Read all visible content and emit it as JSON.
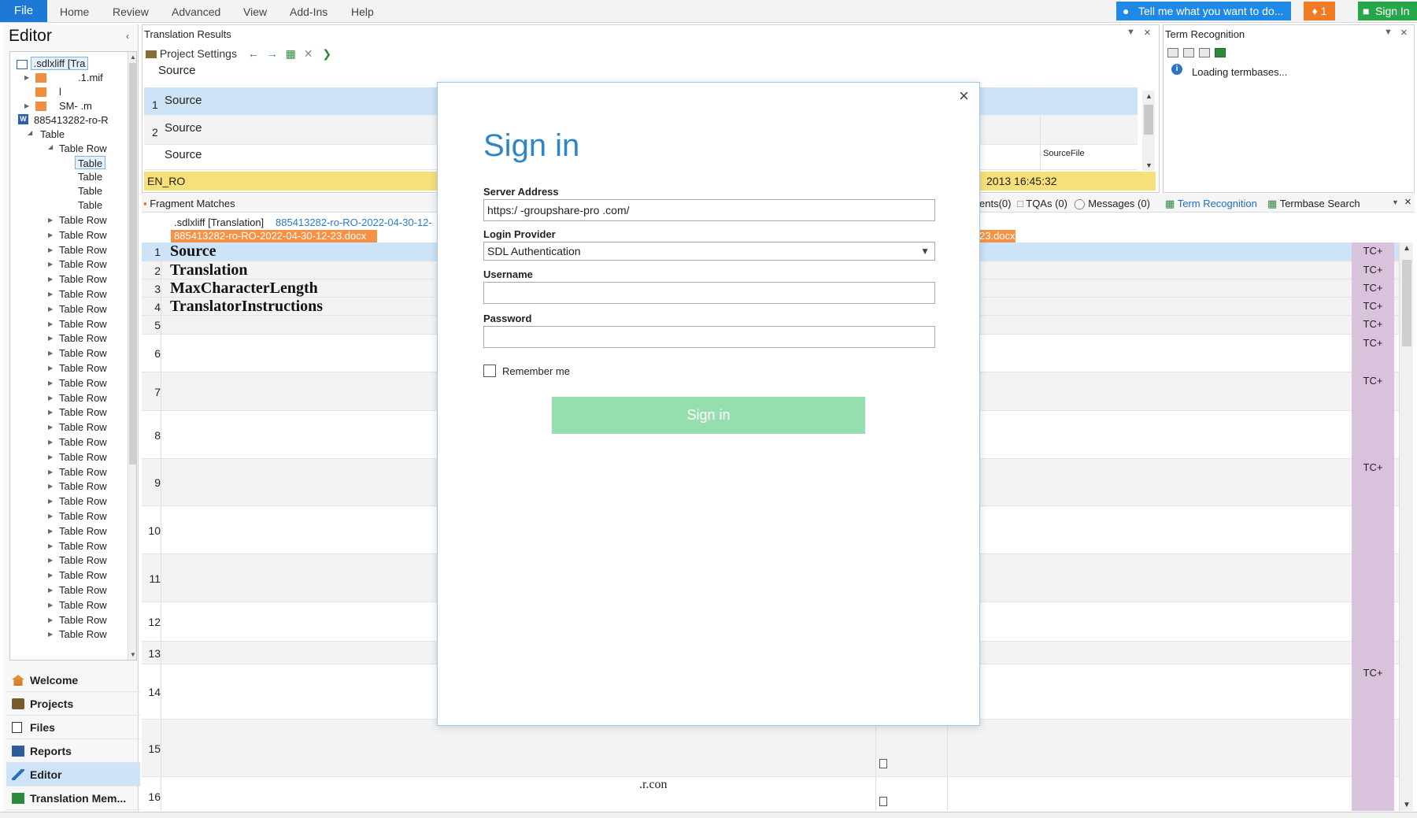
{
  "ribbon": {
    "file": "File",
    "tabs": [
      "Home",
      "Review",
      "Advanced",
      "View",
      "Add-Ins",
      "Help"
    ],
    "tell_me": "Tell me what you want to do...",
    "notifications": "1",
    "sign_in": "Sign In"
  },
  "left_panel": {
    "title": "Editor",
    "tree": {
      "root": ".sdlxliff [Tra",
      "files": [
        ".1.mif",
        "l",
        "SM-       .m"
      ],
      "doc": "885413282-ro-R",
      "table": "Table",
      "table_row": "Table Row",
      "child_tables": [
        "Table",
        "Table",
        "Table",
        "Table"
      ]
    },
    "nav": [
      {
        "label": "Welcome",
        "icon": "home-icon"
      },
      {
        "label": "Projects",
        "icon": "projects-icon"
      },
      {
        "label": "Files",
        "icon": "files-icon"
      },
      {
        "label": "Reports",
        "icon": "reports-icon"
      },
      {
        "label": "Editor",
        "icon": "editor-icon"
      },
      {
        "label": "Translation Mem...",
        "icon": "translation-memory-icon"
      }
    ]
  },
  "translation_results": {
    "title": "Translation Results",
    "project_settings": "Project Settings",
    "source_header": "Source",
    "rows": [
      {
        "num": "1",
        "source": "Source"
      },
      {
        "num": "2",
        "source": "Source"
      },
      {
        "num": "",
        "source": "Source"
      }
    ],
    "source_file": "SourceFile",
    "lang": "EN_RO",
    "date": "2013 16:45:32"
  },
  "term_recognition": {
    "title": "Term Recognition",
    "loading": "Loading termbases..."
  },
  "bottom_tabs": {
    "fragment_matches": "Fragment Matches",
    "comments": "ents(0)",
    "tqas": "TQAs (0)",
    "messages": "Messages (0)",
    "term_recognition": "Term Recognition",
    "termbase_search": "Termbase Search"
  },
  "editor": {
    "doc_tab_1": ".sdlxliff [Translation]",
    "doc_tab_2": "885413282-ro-RO-2022-04-30-12-",
    "doc_bar_left": "885413282-ro-RO-2022-04-30-12-23.docx",
    "doc_bar_right": "23.docx",
    "rows": [
      {
        "n": "1",
        "text": "Source",
        "tc": "TC+"
      },
      {
        "n": "2",
        "text": "Translation",
        "tc": "TC+"
      },
      {
        "n": "3",
        "text": "MaxCharacterLength",
        "tc": "TC+"
      },
      {
        "n": "4",
        "text": "TranslatorInstructions",
        "tc": "TC+"
      },
      {
        "n": "5",
        "text": "",
        "tc": "TC+"
      },
      {
        "n": "6",
        "text": "",
        "tc": "TC+"
      },
      {
        "n": "7",
        "text": "",
        "tc": "TC+"
      },
      {
        "n": "8",
        "text": "",
        "tc": ""
      },
      {
        "n": "9",
        "text": "",
        "tc": "TC+"
      },
      {
        "n": "10",
        "text": "",
        "tc": ""
      },
      {
        "n": "11",
        "text": "",
        "tc": ""
      },
      {
        "n": "12",
        "text": "",
        "tc": ""
      },
      {
        "n": "13",
        "text": "",
        "tc": ""
      },
      {
        "n": "14",
        "text": "",
        "tc": "TC+"
      },
      {
        "n": "15",
        "text": "",
        "tc": ""
      },
      {
        "n": "16",
        "text": "",
        "tc": ""
      }
    ],
    "fragment_text": ".r.con"
  },
  "dialog": {
    "title": "Sign in",
    "server_label": "Server Address",
    "server_value": "https:/      -groupshare-pro            .com/",
    "provider_label": "Login Provider",
    "provider_value": "SDL Authentication",
    "username_label": "Username",
    "username_value": "",
    "password_label": "Password",
    "password_value": "",
    "remember_label": "Remember me",
    "sign_in_button": "Sign in"
  }
}
